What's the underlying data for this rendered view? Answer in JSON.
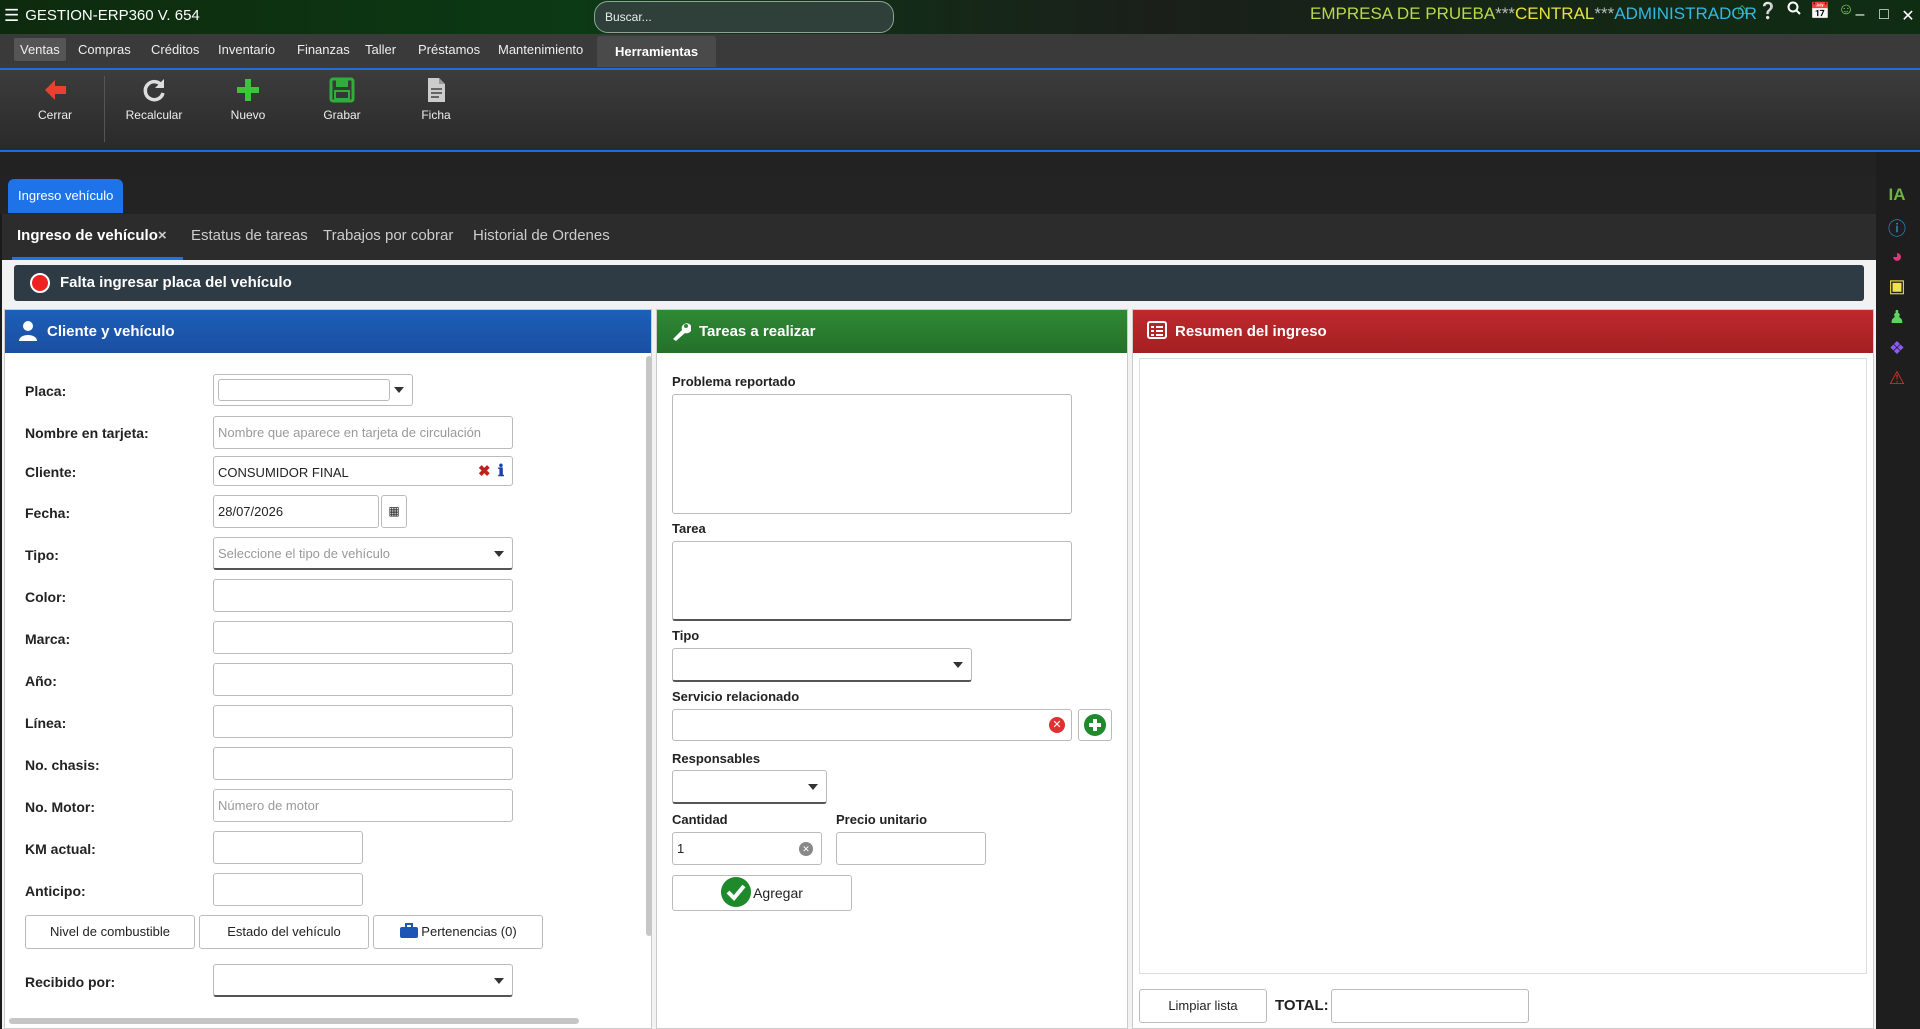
{
  "app": {
    "title": "GESTION-ERP360 V. 654",
    "search_placeholder": "Buscar...",
    "company": "EMPRESA DE PRUEBA",
    "separator": "***",
    "branch": "CENTRAL",
    "user": "ADMINISTRADOR",
    "top_icons": [
      "home-icon",
      "help-icon",
      "search-icon",
      "calendar-icon",
      "smiley-icon"
    ],
    "window_controls": [
      "minimize-icon",
      "maximize-icon",
      "close-icon"
    ]
  },
  "menu": {
    "items": [
      "Ventas",
      "Compras",
      "Créditos",
      "Inventario",
      "Finanzas",
      "Taller",
      "Préstamos",
      "Mantenimiento"
    ],
    "tool_tab": "Herramientas"
  },
  "toolbar": {
    "close_label": "Cerrar",
    "recalc_label": "Recalcular",
    "new_label": "Nuevo",
    "save_label": "Grabar",
    "sheet_label": "Ficha"
  },
  "window_tab": "Ingreso vehículo",
  "subtabs": [
    "Ingreso de vehículo",
    "Estatus de tareas",
    "Trabajos por cobrar",
    "Historial de Ordenes"
  ],
  "subtab_close": "×",
  "alert": "Falta ingresar placa del vehículo",
  "dock": {
    "ia_label": "IA",
    "icons": [
      "info-icon",
      "dashboard-icon",
      "note-icon",
      "user-icon",
      "puzzle-icon",
      "warning-icon"
    ]
  },
  "client_panel": {
    "title": "Cliente y vehículo",
    "labels": {
      "placa": "Placa:",
      "nombre": "Nombre en tarjeta:",
      "cliente": "Cliente:",
      "fecha": "Fecha:",
      "tipo": "Tipo:",
      "color": "Color:",
      "marca": "Marca:",
      "anio": "Año:",
      "linea": "Línea:",
      "chasis": "No. chasis:",
      "motor": "No. Motor:",
      "km": "KM actual:",
      "anticipo": "Anticipo:",
      "recibido": "Recibido por:"
    },
    "nombre_placeholder": "Nombre que aparece en tarjeta de circulación",
    "cliente_value": "CONSUMIDOR FINAL",
    "fecha_value": "28/07/2026",
    "tipo_placeholder": "Seleccione el tipo de vehículo",
    "motor_placeholder": "Número de motor",
    "buttons": {
      "fuel": "Nivel de combustible",
      "state": "Estado del vehículo",
      "belongings": "Pertenencias (0)"
    }
  },
  "tasks_panel": {
    "title": "Tareas a realizar",
    "problem_label": "Problema reportado",
    "task_label": "Tarea",
    "type_label": "Tipo",
    "service_label": "Servicio relacionado",
    "responsible_label": "Responsables",
    "qty_label": "Cantidad",
    "qty_value": "1",
    "price_label": "Precio unitario",
    "add_label": "Agregar"
  },
  "summary_panel": {
    "title": "Resumen del ingreso",
    "clear_label": "Limpiar lista",
    "total_label": "TOTAL:"
  }
}
